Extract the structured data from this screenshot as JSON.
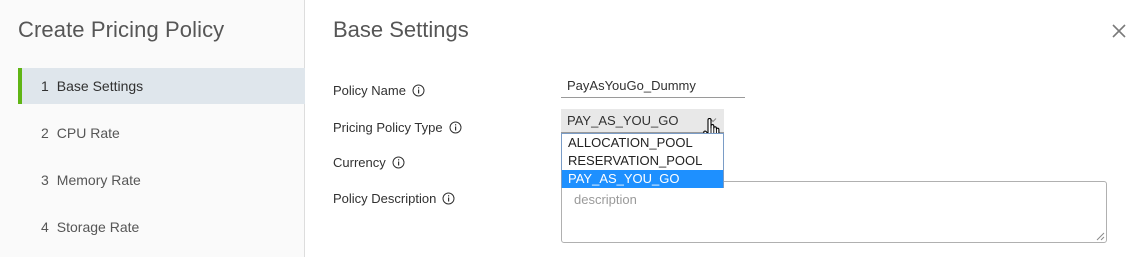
{
  "wizard": {
    "title": "Create Pricing Policy",
    "steps": [
      {
        "num": "1",
        "label": "Base Settings"
      },
      {
        "num": "2",
        "label": "CPU Rate"
      },
      {
        "num": "3",
        "label": "Memory Rate"
      },
      {
        "num": "4",
        "label": "Storage Rate"
      }
    ],
    "active_step": 1
  },
  "page": {
    "title": "Base Settings"
  },
  "form": {
    "policy_name": {
      "label": "Policy Name",
      "value": "PayAsYouGo_Dummy"
    },
    "pricing_policy_type": {
      "label": "Pricing Policy Type",
      "value": "PAY_AS_YOU_GO",
      "options": [
        "ALLOCATION_POOL",
        "RESERVATION_POOL",
        "PAY_AS_YOU_GO"
      ],
      "highlighted_option": "PAY_AS_YOU_GO"
    },
    "currency": {
      "label": "Currency"
    },
    "policy_description": {
      "label": "Policy Description",
      "placeholder": "description",
      "value": ""
    }
  },
  "colors": {
    "active_step_bar": "#60b515",
    "active_step_bg": "#dfe6ec",
    "dropdown_highlight": "#1e90ff"
  },
  "icons": {
    "close": "close-icon",
    "info": "info-icon",
    "chevron": "chevron-down-icon",
    "cursor": "hand-pointer-cursor"
  }
}
